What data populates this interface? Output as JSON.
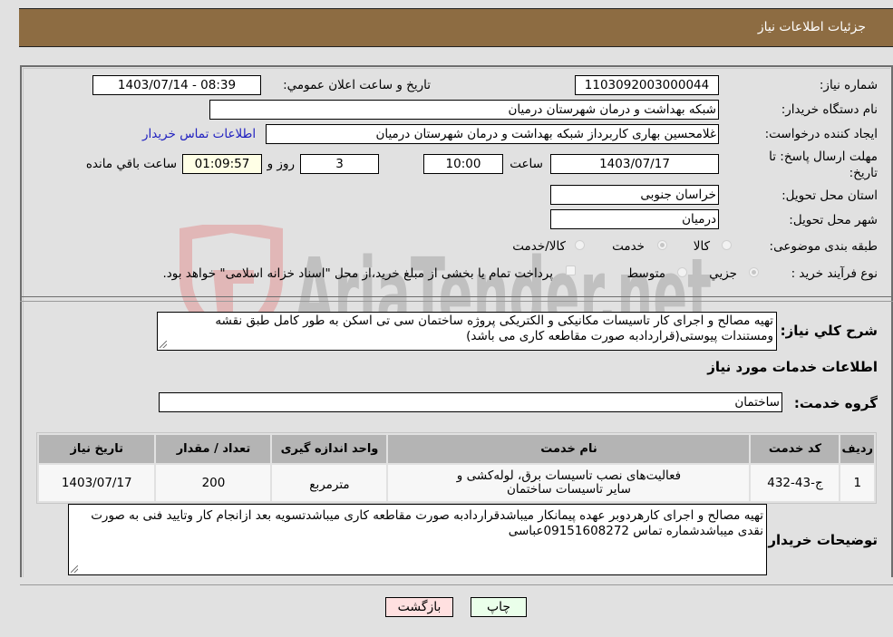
{
  "header": {
    "title": "جزئیات اطلاعات نیاز"
  },
  "form": {
    "need_number": {
      "label": "شماره نیاز:",
      "value": "1103092003000044"
    },
    "announce_datetime": {
      "label": "تاريخ و ساعت اعلان عمومي:",
      "value": "1403/07/14 - 08:39"
    },
    "buyer_org": {
      "label": "نام دستگاه خريدار:",
      "value": "شبکه بهداشت و درمان شهرستان درمیان"
    },
    "requester": {
      "label": "ايجاد کننده درخواست:",
      "value": "غلامحسین بهاری کاربرداز شبکه بهداشت و درمان شهرستان درمیان"
    },
    "buyer_contact_link": "اطلاعات تماس خريدار",
    "deadline": {
      "label_line1": "مهلت ارسال پاسخ: تا",
      "label_line2": "تاريخ:",
      "date": "1403/07/17",
      "time_label": "ساعت",
      "time": "10:00",
      "days": "3",
      "days_label": "روز و",
      "remaining": "01:09:57",
      "remaining_label": "ساعت باقي مانده"
    },
    "province": {
      "label": "استان محل تحويل:",
      "value": "خراسان جنوبی"
    },
    "city": {
      "label": "شهر محل تحويل:",
      "value": "درمیان"
    },
    "category": {
      "label": "طبقه بندی موضوعی:",
      "options": [
        {
          "label": "کالا",
          "selected": false
        },
        {
          "label": "خدمت",
          "selected": true
        },
        {
          "label": "کالا/خدمت",
          "selected": false
        }
      ]
    },
    "process": {
      "label": "نوع فرآيند خريد :",
      "options": [
        {
          "label": "جزيي",
          "selected": true
        },
        {
          "label": "متوسط",
          "selected": false
        }
      ],
      "treasury_checkbox_label": "پرداخت تمام يا بخشی از مبلغ خريد،از محل \"اسناد خزانه اسلامی\" خواهد بود.",
      "treasury_checked": false
    },
    "summary": {
      "label": "شرح کلي نياز:",
      "value": "تهیه مصالح و اجرای کار  تاسیسات مکانیکی و الکتریکی پروژه ساختمان سی تی اسکن به طور کامل طبق نقشه ومستندات پیوستی(قراردادبه صورت مقاطعه کاری می باشد)"
    }
  },
  "services_section": {
    "title": "اطلاعات خدمات مورد نياز",
    "group_label": "گروه خدمت:",
    "group_value": "ساختمان",
    "table": {
      "headers": [
        "رديف",
        "کد خدمت",
        "نام خدمت",
        "واحد اندازه گیری",
        "تعداد / مقدار",
        "تاريخ نياز"
      ],
      "rows": [
        [
          "1",
          "ج-43-432",
          "فعالیت‌های نصب تاسیسات برق، لوله‌کشی و سایر تاسیسات ساختمان",
          "مترمربع",
          "200",
          "1403/07/17"
        ]
      ]
    }
  },
  "buyer_notes": {
    "label": "توضيحات خريدار:",
    "value": "تهیه مصالح و اجرای کارهردوبر عهده پیمانکار میباشدقراردادبه صورت مقاطعه کاری میباشدتسویه بعد ازانجام کار وتایید فنی به صورت نقدی میباشدشماره تماس 09151608272عباسی"
  },
  "buttons": {
    "print": "چاپ",
    "back": "بازگشت"
  },
  "watermark": {
    "text": "AriaTender.net"
  },
  "colors": {
    "header_bg": "#8d6c42",
    "print_bg": "#eaffea",
    "back_bg": "#ffe0e0",
    "link": "#2020c0"
  }
}
